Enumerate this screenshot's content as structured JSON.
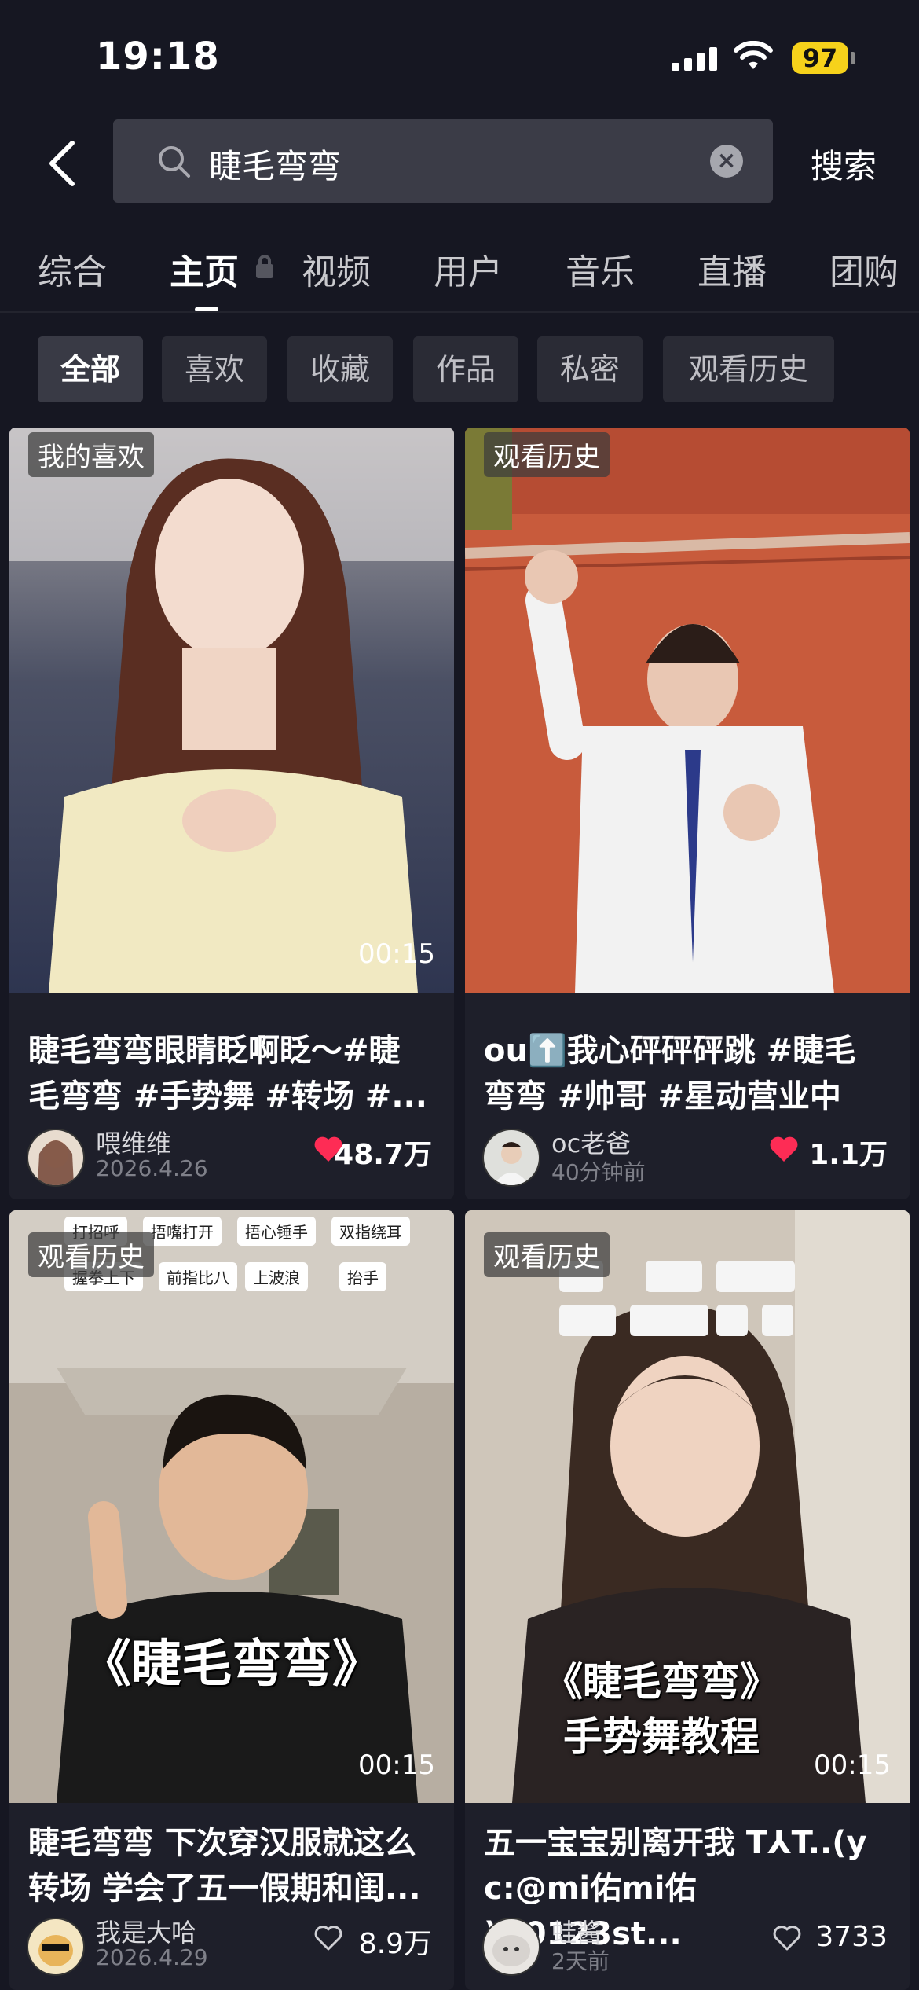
{
  "status_bar": {
    "time": "19:18",
    "battery": "97"
  },
  "search": {
    "query": "睫毛弯弯",
    "button": "搜索"
  },
  "tabs": [
    {
      "label": "综合"
    },
    {
      "label": "主页"
    },
    {
      "label": "视频"
    },
    {
      "label": "用户"
    },
    {
      "label": "音乐"
    },
    {
      "label": "直播"
    },
    {
      "label": "团购"
    }
  ],
  "filters": [
    {
      "label": "全部"
    },
    {
      "label": "喜欢"
    },
    {
      "label": "收藏"
    },
    {
      "label": "作品"
    },
    {
      "label": "私密"
    },
    {
      "label": "观看历史"
    }
  ],
  "videos": [
    {
      "tag": "我的喜欢",
      "duration": "00:15",
      "caption": "睫毛弯弯眼睛眨啊眨～#睫\n毛弯弯 #手势舞 #转场 #...",
      "author": "喂维维",
      "date": "2026.4.26",
      "likes": "48.7万",
      "liked": true
    },
    {
      "tag": "观看历史",
      "duration": "",
      "caption": "ou⬆️我心砰砰砰跳 #睫毛\n弯弯 #帅哥 #星动营业中",
      "author": "oc老爸",
      "date": "40分钟前",
      "likes": "1.1万",
      "liked": true
    },
    {
      "tag": "观看历史",
      "duration": "00:15",
      "caption": "睫毛弯弯 下次穿汉服就这么\n转场 学会了五一假期和闺...",
      "author": "我是大哈",
      "date": "2026.4.29",
      "likes": "8.9万",
      "liked": false,
      "overlay_title": "《睫毛弯弯》",
      "gesture_labels": [
        "打招呼",
        "捂嘴打开",
        "捂心锤手",
        "双指绕耳",
        "握拳上下",
        "前指比八",
        "上波浪",
        "抬手"
      ]
    },
    {
      "tag": "观看历史",
      "duration": "00:15",
      "caption": "五一宝宝别离开我 T⅄T..(y\nc:@mi佑mi佑 )#0123st...",
      "author": "蛙酱",
      "date": "2天前",
      "likes": "3733",
      "liked": false,
      "overlay_title": "《睫毛弯弯》",
      "overlay_subtitle": "手势舞教程"
    }
  ],
  "colors": {
    "background": "#161722",
    "like": "#fe2c55",
    "battery": "#f6d21b"
  }
}
